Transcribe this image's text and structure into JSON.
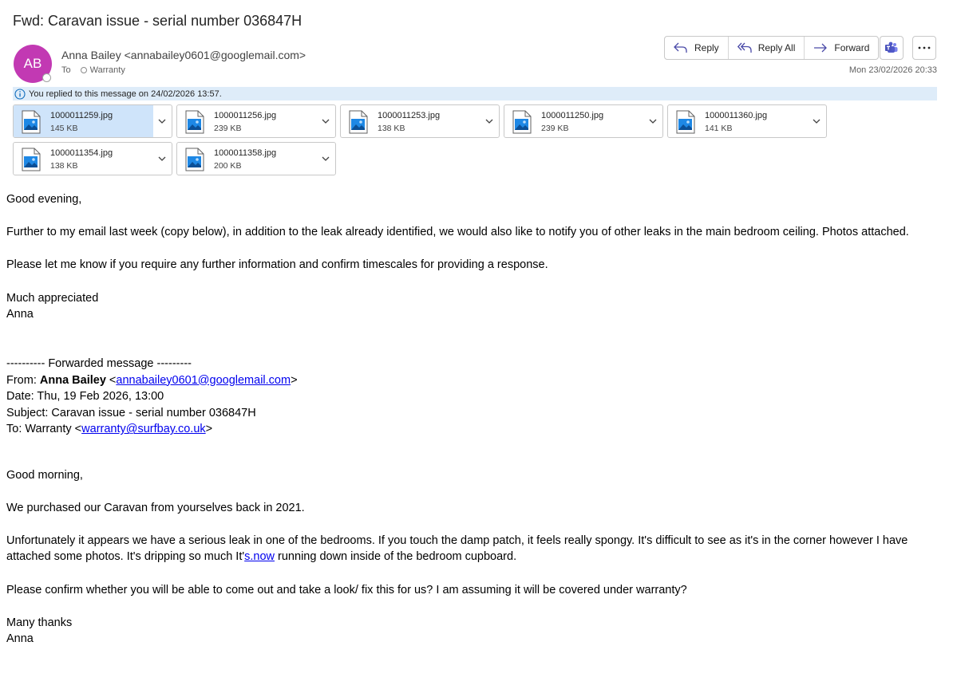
{
  "email": {
    "subject": "Fwd: Caravan issue - serial number 036847H",
    "avatar_initials": "AB",
    "avatar_color": "#c239b3",
    "sender_display": "Anna Bailey <annabailey0601@googlemail.com>",
    "to_label": "To",
    "recipient": "Warranty",
    "date": "Mon 23/02/2026 20:33",
    "info_text": "You replied to this message on 24/02/2026 13:57."
  },
  "actions": {
    "reply": "Reply",
    "reply_all": "Reply All",
    "forward": "Forward"
  },
  "icons": {
    "reply": "reply-arrow-icon",
    "reply_all": "reply-all-icon",
    "forward": "forward-arrow-icon",
    "teams": "teams-icon",
    "more": "more-ellipsis-icon",
    "info": "info-circle-icon",
    "attachment": "image-file-icon",
    "chevron": "chevron-down-icon"
  },
  "attachments": [
    {
      "name": "1000011259.jpg",
      "size": "145 KB",
      "selected": true
    },
    {
      "name": "1000011256.jpg",
      "size": "239 KB"
    },
    {
      "name": "1000011253.jpg",
      "size": "138 KB"
    },
    {
      "name": "1000011250.jpg",
      "size": "239 KB"
    },
    {
      "name": "1000011360.jpg",
      "size": "141 KB"
    },
    {
      "name": "1000011354.jpg",
      "size": "138 KB"
    },
    {
      "name": "1000011358.jpg",
      "size": "200 KB"
    }
  ],
  "body": {
    "greeting": "Good evening,",
    "p1": "Further to my email last week (copy below), in addition to the leak already identified, we would also like to notify you of other leaks in the main bedroom ceiling. Photos attached.",
    "p2": "Please let me know if you require any further information and confirm timescales for providing a response.",
    "signoff": "Much appreciated",
    "name": "Anna",
    "fwd_header": "---------- Forwarded message ---------",
    "from_label": "From: ",
    "from_name": "Anna Bailey",
    "from_lt": " <",
    "from_email": "annabailey0601@googlemail.com",
    "from_gt": ">",
    "date_line": "Date: Thu, 19 Feb 2026, 13:00",
    "subject_line": "Subject: Caravan issue - serial number 036847H",
    "to_label": "To: Warranty <",
    "to_email": "warranty@surfbay.co.uk",
    "to_gt": ">",
    "greeting2": "Good morning,",
    "q1": "We purchased our Caravan from yourselves back in 2021.",
    "q2a": "Unfortunately it appears we have a serious leak in one of the bedrooms. If you touch the damp patch, it feels really spongy. It's difficult to see as it's in the corner however I have attached some photos. It's dripping so much It'",
    "q2_link": "s.now",
    "q2b": " running down inside of the bedroom cupboard.",
    "q3": "Please confirm whether you will be able to come out and take a look/ fix this for us? I am assuming it will be covered under warranty?",
    "signoff2": "Many thanks",
    "name2": "Anna"
  }
}
